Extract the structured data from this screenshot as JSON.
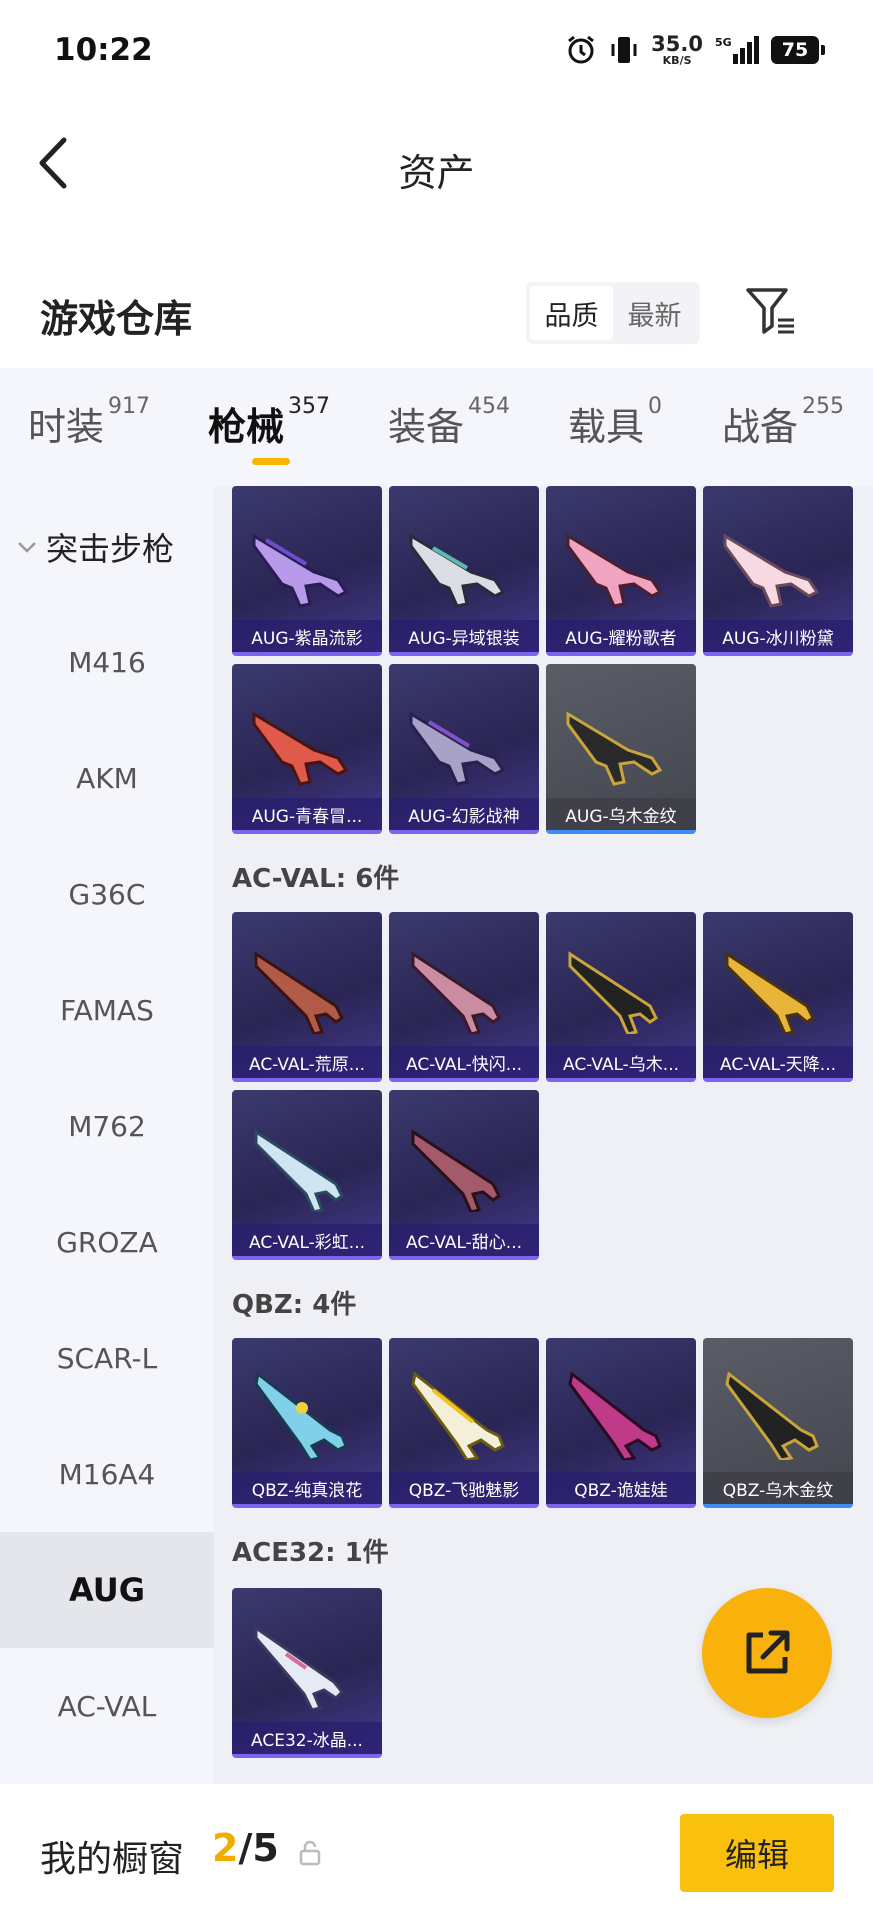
{
  "status_bar": {
    "time": "10:22",
    "net_speed": "35.0",
    "net_unit": "KB/S",
    "network": "5G",
    "battery": "75"
  },
  "header": {
    "title": "资产"
  },
  "warehouse": {
    "title": "游戏仓库",
    "sort_options": [
      "品质",
      "最新"
    ]
  },
  "tabs": [
    {
      "label": "时装",
      "count": "917"
    },
    {
      "label": "枪械",
      "count": "357"
    },
    {
      "label": "装备",
      "count": "454"
    },
    {
      "label": "载具",
      "count": "0"
    },
    {
      "label": "战备",
      "count": "255"
    }
  ],
  "sidebar": {
    "group": "突击步枪",
    "items": [
      "M416",
      "AKM",
      "G36C",
      "FAMAS",
      "M762",
      "GROZA",
      "SCAR-L",
      "M16A4",
      "AUG",
      "AC-VAL"
    ]
  },
  "sections": {
    "acval": "AC-VAL: 6件",
    "qbz": "QBZ: 4件",
    "ace32": "ACE32: 1件"
  },
  "cards": {
    "aug": [
      "AUG-紫晶流影",
      "AUG-异域银装",
      "AUG-耀粉歌者",
      "AUG-冰川粉黛",
      "AUG-青春冒...",
      "AUG-幻影战神",
      "AUG-乌木金纹"
    ],
    "acval": [
      "AC-VAL-荒原...",
      "AC-VAL-快闪...",
      "AC-VAL-乌木...",
      "AC-VAL-天降...",
      "AC-VAL-彩虹...",
      "AC-VAL-甜心..."
    ],
    "qbz": [
      "QBZ-纯真浪花",
      "QBZ-飞驰魅影",
      "QBZ-诡娃娃",
      "QBZ-乌木金纹"
    ],
    "ace32": [
      "ACE32-冰晶..."
    ]
  },
  "bottom": {
    "label": "我的橱窗",
    "current": "2",
    "separator": "/",
    "total": "5",
    "edit": "编辑"
  },
  "colors": {
    "accent": "#f9b10b",
    "card_purple": "#2a2554",
    "card_grey": "#4a4d55"
  }
}
